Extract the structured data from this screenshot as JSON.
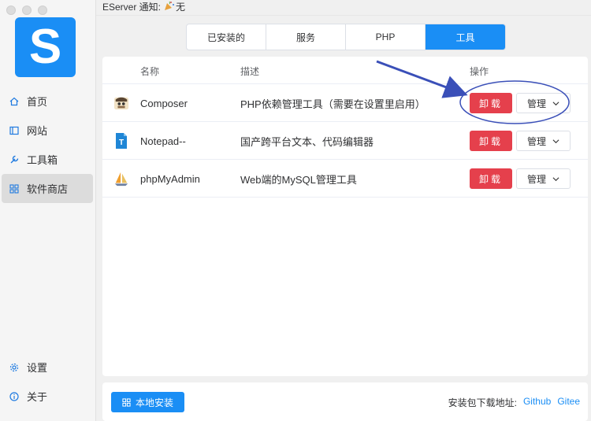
{
  "window": {
    "traffic_lights": [
      "close",
      "minimize",
      "zoom"
    ]
  },
  "brand": {
    "logo_letter": "S",
    "accent": "#1a8ef5"
  },
  "notice": {
    "prefix": "EServer 通知:",
    "emoji_icon": "party-popper-icon",
    "text": "无"
  },
  "sidebar": {
    "items": [
      {
        "label": "首页",
        "icon": "home-icon"
      },
      {
        "label": "网站",
        "icon": "website-icon"
      },
      {
        "label": "工具箱",
        "icon": "wrench-icon"
      },
      {
        "label": "软件商店",
        "icon": "grid-icon",
        "active": true
      }
    ],
    "bottom_items": [
      {
        "label": "设置",
        "icon": "gear-icon"
      },
      {
        "label": "关于",
        "icon": "info-icon"
      }
    ]
  },
  "tabs": [
    {
      "label": "已安装的"
    },
    {
      "label": "服务"
    },
    {
      "label": "PHP"
    },
    {
      "label": "工具",
      "active": true
    }
  ],
  "table": {
    "headers": {
      "name": "名称",
      "desc": "描述",
      "action": "操作"
    },
    "rows": [
      {
        "name": "Composer",
        "desc": "PHP依赖管理工具（需要在设置里启用）",
        "icon": "composer-icon",
        "uninstall": "卸载",
        "manage": "管理"
      },
      {
        "name": "Notepad--",
        "desc": "国产跨平台文本、代码编辑器",
        "icon": "notepad-icon",
        "uninstall": "卸载",
        "manage": "管理"
      },
      {
        "name": "phpMyAdmin",
        "desc": "Web端的MySQL管理工具",
        "icon": "phpmyadmin-icon",
        "uninstall": "卸载",
        "manage": "管理"
      }
    ]
  },
  "footer": {
    "local_install": "本地安装",
    "download_label": "安装包下载地址:",
    "links": [
      "Github",
      "Gitee"
    ]
  },
  "colors": {
    "danger": "#e5404c",
    "annotation": "#3a4fb8"
  }
}
